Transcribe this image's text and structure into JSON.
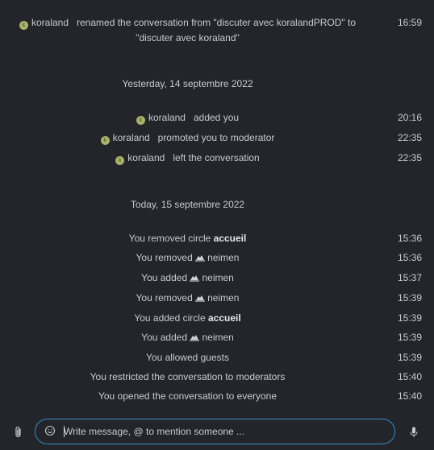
{
  "messages": [
    {
      "kind": "rename",
      "user": "koraland",
      "avatar": "k",
      "line1": "renamed the conversation from \"discuter avec koralandPROD\" to",
      "line2": "\"discuter avec koraland\"",
      "time": "16:59"
    }
  ],
  "separators": {
    "yesterday": "Yesterday, 14 septembre 2022",
    "today": "Today, 15 septembre 2022"
  },
  "yesterday": [
    {
      "user": "koraland",
      "avatar": "k",
      "text": "added you",
      "time": "20:16"
    },
    {
      "user": "koraland",
      "avatar": "k",
      "text": "promoted you to moderator",
      "time": "22:35"
    },
    {
      "user": "koraland",
      "avatar": "k",
      "text": "left the conversation",
      "time": "22:35"
    }
  ],
  "today": [
    {
      "prefix": "You removed circle",
      "bold": "accueil",
      "time": "15:36"
    },
    {
      "prefix": "You removed",
      "user": "neimen",
      "time": "15:36"
    },
    {
      "prefix": "You added",
      "user": "neimen",
      "time": "15:37"
    },
    {
      "prefix": "You removed",
      "user": "neimen",
      "time": "15:39"
    },
    {
      "prefix": "You added circle",
      "bold": "accueil",
      "time": "15:39"
    },
    {
      "prefix": "You added",
      "user": "neimen",
      "time": "15:39"
    },
    {
      "prefix": "You allowed guests",
      "time": "15:39"
    },
    {
      "prefix": "You restricted the conversation to moderators",
      "time": "15:40"
    },
    {
      "prefix": "You opened the conversation to everyone",
      "time": "15:40"
    }
  ],
  "composer": {
    "placeholder": "Write message, @ to mention someone ...",
    "value": ""
  },
  "icons": {
    "attach": "paperclip-icon",
    "emoji": "emoji-icon",
    "mic": "microphone-icon"
  }
}
